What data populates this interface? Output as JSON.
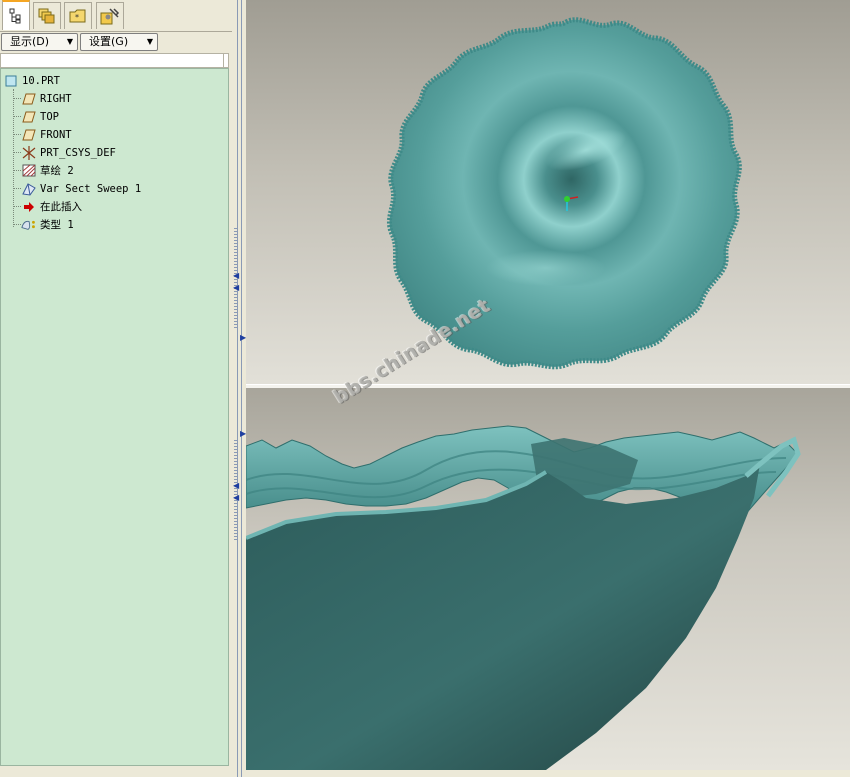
{
  "nav_tabs": [
    {
      "icon": "model-tree-icon",
      "active": true
    },
    {
      "icon": "layers-icon",
      "active": false
    },
    {
      "icon": "folder-browser-icon",
      "active": false
    },
    {
      "icon": "favorites-tools-icon",
      "active": false
    }
  ],
  "toolbar": {
    "display_label": "显示(D)",
    "settings_label": "设置(G)"
  },
  "model_tree": {
    "root": {
      "label": "10.PRT",
      "icon": "part-icon"
    },
    "items": [
      {
        "label": "RIGHT",
        "icon": "datum-plane-icon"
      },
      {
        "label": "TOP",
        "icon": "datum-plane-icon"
      },
      {
        "label": "FRONT",
        "icon": "datum-plane-icon"
      },
      {
        "label": "PRT_CSYS_DEF",
        "icon": "coordinate-system-icon"
      },
      {
        "label": "草绘 2",
        "icon": "sketch-icon"
      },
      {
        "label": "Var Sect Sweep 1",
        "icon": "variable-section-sweep-icon"
      },
      {
        "label": "在此插入",
        "icon": "insert-here-arrow-icon"
      },
      {
        "label": "类型 1",
        "icon": "pattern-feature-icon"
      }
    ]
  },
  "watermark": "bbs.chinade.net",
  "colors": {
    "tree_background": "#cde8d0",
    "model_surface": "#5aa6a4",
    "model_dark": "#2d5c5b",
    "insert_arrow": "#cc0000"
  }
}
